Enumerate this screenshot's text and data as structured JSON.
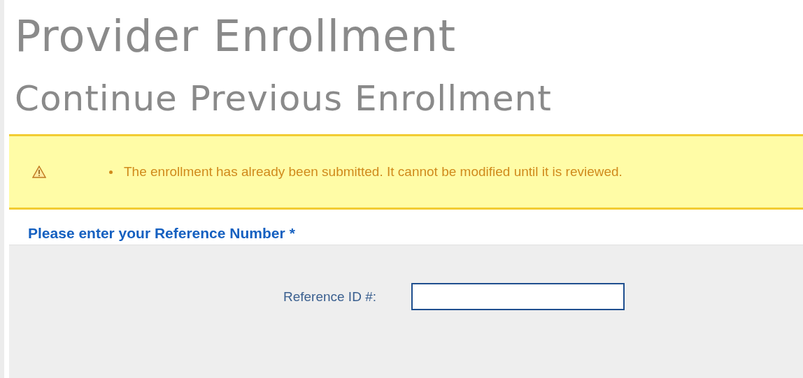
{
  "page": {
    "title": "Provider Enrollment",
    "subtitle": "Continue Previous Enrollment"
  },
  "alert": {
    "kind": "warning",
    "messages": [
      "The enrollment has already been submitted. It cannot be modified until it is reviewed."
    ]
  },
  "section": {
    "heading": "Please enter your Reference Number",
    "required_mark": "*"
  },
  "form": {
    "fields": [
      {
        "label": "Reference ID #:"
      }
    ]
  }
}
